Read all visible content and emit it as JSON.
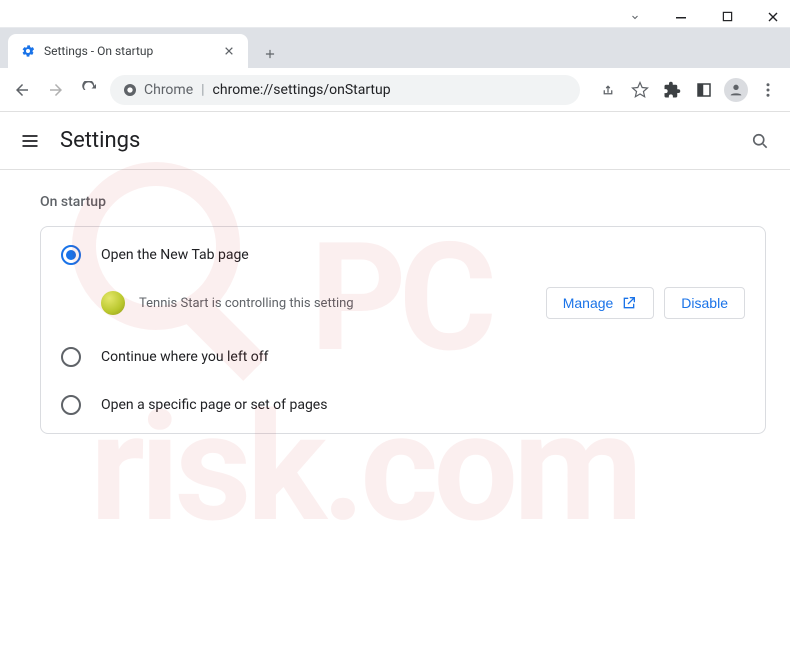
{
  "window": {
    "tab_title": "Settings - On startup"
  },
  "omnibox": {
    "origin_label": "Chrome",
    "url": "chrome://settings/onStartup"
  },
  "header": {
    "title": "Settings"
  },
  "section": {
    "title": "On startup"
  },
  "options": {
    "new_tab": "Open the New Tab page",
    "continue": "Continue where you left off",
    "specific": "Open a specific page or set of pages"
  },
  "controlled": {
    "text": "Tennis Start is controlling this setting",
    "manage_label": "Manage",
    "disable_label": "Disable"
  }
}
